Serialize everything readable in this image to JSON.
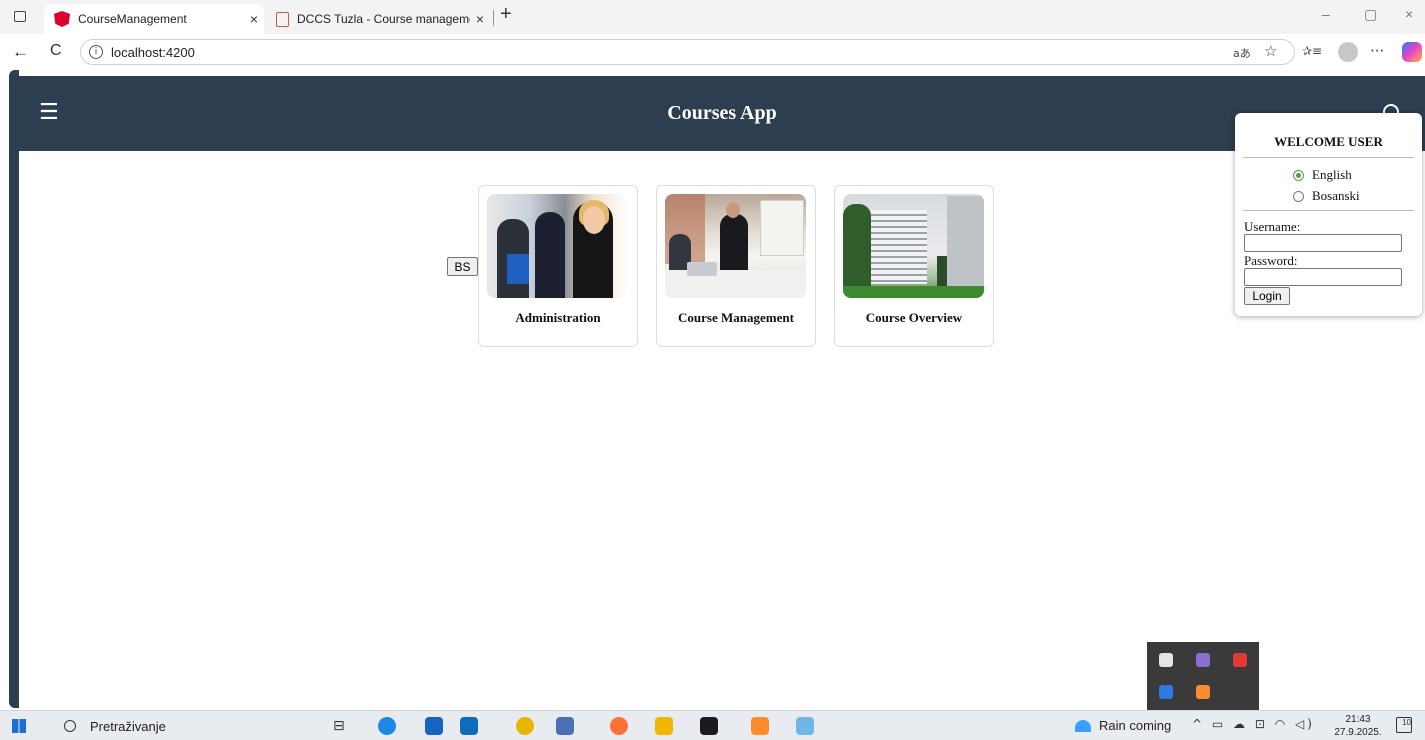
{
  "browser": {
    "tabs": [
      {
        "label": "CourseManagement",
        "active": true
      },
      {
        "label": "DCCS Tuzla - Course managemen",
        "active": false
      }
    ],
    "tab_close_glyph": "×",
    "new_tab_glyph": "+",
    "window_controls": [
      "–",
      "▢",
      "×"
    ],
    "back_glyph": "←",
    "reload_glyph": "C",
    "url": "localhost:4200",
    "toolbar_glyphs": [
      "aあ",
      "☆",
      "✰≡",
      "···"
    ]
  },
  "app": {
    "title": "Courses App",
    "menu_glyph": "☰",
    "header_bg": "#2c3e50",
    "lang_button": "BS",
    "cards": [
      {
        "label": "Administration",
        "image": "business-team-photo"
      },
      {
        "label": "Course Management",
        "image": "meeting-room-photo"
      },
      {
        "label": "Course Overview",
        "image": "campus-building-photo"
      }
    ]
  },
  "login": {
    "welcome": "WELCOME USER",
    "languages": [
      {
        "label": "English",
        "checked": true
      },
      {
        "label": "Bosanski",
        "checked": false
      }
    ],
    "username_label": "Username:",
    "username_value": "",
    "password_label": "Password:",
    "password_value": "",
    "login_button": "Login"
  },
  "taskbar": {
    "search_placeholder": "Pretraživanje",
    "weather": "Rain coming",
    "tray_glyphs": "^ ▭ ☁ ⊡ ◠ ◁)",
    "time": "21:43",
    "date": "27.9.2025.",
    "notification_count": "10"
  }
}
